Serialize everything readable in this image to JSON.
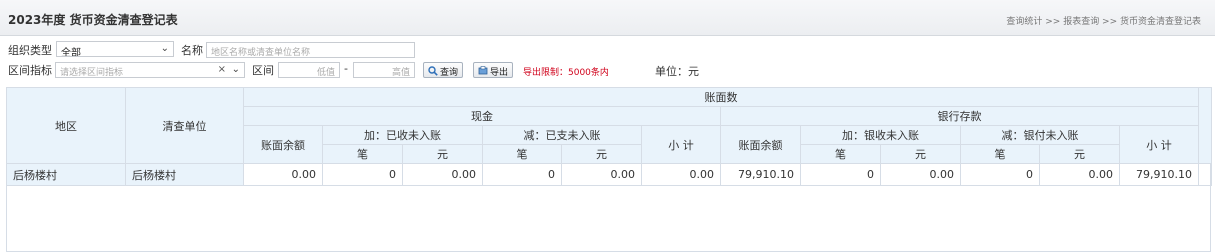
{
  "header": {
    "title": "2023年度 货币资金清查登记表",
    "breadcrumb": "查询统计 >> 报表查询 >> 货币资金清查登记表"
  },
  "filters": {
    "org_type_label": "组织类型",
    "org_type_value": "全部",
    "name_label": "名称",
    "name_placeholder": "地区名称或清查单位名称",
    "range_indicator_label": "区间指标",
    "range_indicator_placeholder": "请选择区间指标",
    "range_label": "区间",
    "range_low_placeholder": "低值",
    "range_dash": "-",
    "range_high_placeholder": "高值",
    "query_button": "查询",
    "export_button": "导出",
    "export_limit": "导出限制：5000条内",
    "unit": "单位：元"
  },
  "table": {
    "col_region": "地区",
    "col_unit": "清查单位",
    "group_book": "账面数",
    "group_cash": "现金",
    "group_bank": "银行存款",
    "book_balance": "账面余额",
    "cash_add": "加：已收未入账",
    "cash_sub": "减：已支未入账",
    "bank_add": "加：银收未入账",
    "bank_sub": "减：银付未入账",
    "count": "笔",
    "yuan": "元",
    "subtotal": "小 计",
    "rows": [
      {
        "region": "后杨楼村",
        "unit": "后杨楼村",
        "cash_balance": "0.00",
        "cash_add_count": "0",
        "cash_add_yuan": "0.00",
        "cash_sub_count": "0",
        "cash_sub_yuan": "0.00",
        "cash_subtotal": "0.00",
        "bank_balance": "79,910.10",
        "bank_add_count": "0",
        "bank_add_yuan": "0.00",
        "bank_sub_count": "0",
        "bank_sub_yuan": "0.00",
        "bank_subtotal": "79,910.10"
      }
    ]
  }
}
